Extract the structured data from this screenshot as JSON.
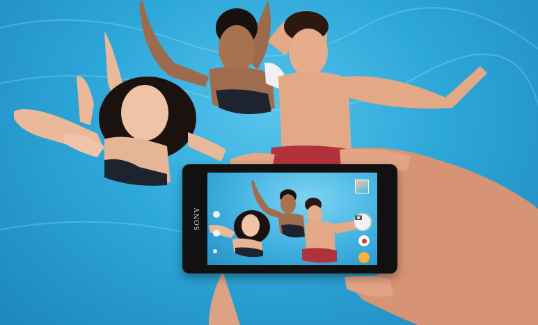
{
  "phone": {
    "brand": "SONY"
  },
  "colors": {
    "water": "#2ea7d9",
    "skin": "#e9b99a",
    "hair": "#1b1210",
    "swimwear": "#1d2430",
    "shorts": "#b2323b",
    "phone_body": "#111111"
  },
  "icons": {
    "shutter": "camera-icon",
    "record": "record-icon",
    "mode": "scene-mode-icon",
    "gallery": "gallery-thumbnail"
  }
}
